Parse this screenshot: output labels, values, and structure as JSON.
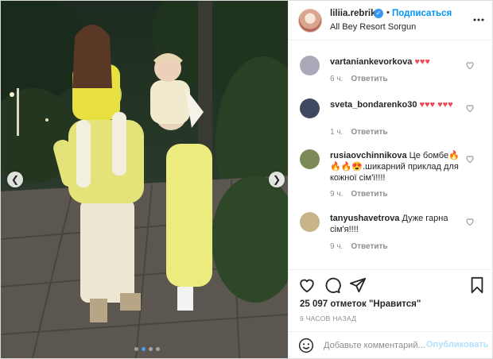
{
  "post": {
    "username": "liliia.rebrik",
    "verified": true,
    "separator": "•",
    "follow_label": "Подписаться",
    "location": "All Bey Resort Sorgun",
    "photo_count": 4,
    "active_photo_index": 1
  },
  "comments": [
    {
      "user": "vartaniankevorkova",
      "text": "♥♥♥",
      "time": "6 ч.",
      "reply": "Ответить",
      "avatar_color": "#a8a8b8"
    },
    {
      "user": "sveta_bondarenko30",
      "text": "♥♥♥ ♥♥♥",
      "time": "1 ч.",
      "reply": "Ответить",
      "avatar_color": "#3f4960"
    },
    {
      "user": "rusiaovchinnikova",
      "text": "Це бомбе🔥🔥🔥😍.шикарний приклад для кожної сім'ї!!!!",
      "time": "9 ч.",
      "reply": "Ответить",
      "avatar_color": "#7c8a5a"
    },
    {
      "user": "tanyushavetrova",
      "text": "Дуже гарна сім'я!!!!",
      "time": "9 ч.",
      "reply": "Ответить",
      "avatar_color": "#c7b48a"
    }
  ],
  "stats": {
    "likes": "25 097 отметок \"Нравится\"",
    "posted": "9 часов назад"
  },
  "composer": {
    "placeholder": "Добавьте комментарий...",
    "post_label": "Опубликовать"
  },
  "colors": {
    "accent": "#0095f6",
    "heart_red": "#ed4956",
    "muted": "#8e8e8e"
  }
}
